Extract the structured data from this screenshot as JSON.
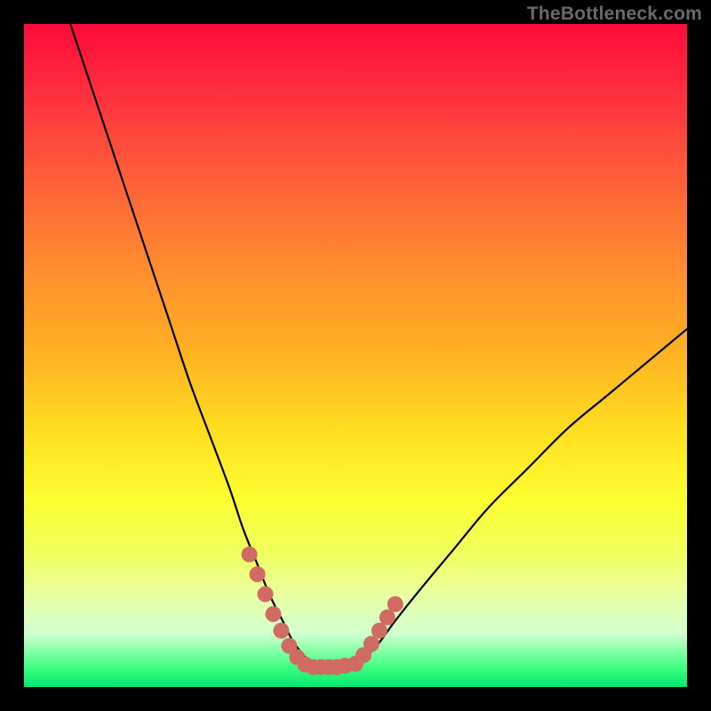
{
  "watermark": {
    "text": "TheBottleneck.com"
  },
  "chart_data": {
    "type": "line",
    "title": "",
    "xlabel": "",
    "ylabel": "",
    "xlim": [
      0,
      100
    ],
    "ylim": [
      0,
      100
    ],
    "grid": false,
    "series": [
      {
        "name": "bottleneck-curve",
        "color": "#000000",
        "x": [
          7,
          10,
          13,
          16,
          19,
          22,
          25,
          28,
          31,
          33,
          35,
          37,
          39,
          40.5,
          42,
          43.5,
          45,
          47,
          49,
          50,
          53,
          56,
          60,
          65,
          70,
          76,
          82,
          88,
          94,
          100
        ],
        "y": [
          100,
          91,
          82,
          73,
          64,
          55,
          46,
          38,
          30,
          24,
          19,
          14,
          10,
          7,
          5,
          3.5,
          3,
          3,
          3.2,
          3.5,
          6,
          10,
          15,
          21,
          27,
          33,
          39,
          44,
          49,
          54
        ]
      },
      {
        "name": "marker-dots",
        "color": "#cf6b63",
        "points": [
          {
            "x": 34.0,
            "y": 20.0
          },
          {
            "x": 35.2,
            "y": 17.0
          },
          {
            "x": 36.4,
            "y": 14.0
          },
          {
            "x": 37.6,
            "y": 11.0
          },
          {
            "x": 38.8,
            "y": 8.5
          },
          {
            "x": 40.0,
            "y": 6.2
          },
          {
            "x": 41.2,
            "y": 4.5
          },
          {
            "x": 42.4,
            "y": 3.4
          },
          {
            "x": 43.6,
            "y": 3.0
          },
          {
            "x": 44.8,
            "y": 3.0
          },
          {
            "x": 46.0,
            "y": 3.0
          },
          {
            "x": 47.2,
            "y": 3.0
          },
          {
            "x": 48.4,
            "y": 3.2
          },
          {
            "x": 50.0,
            "y": 3.5
          },
          {
            "x": 51.2,
            "y": 4.8
          },
          {
            "x": 52.4,
            "y": 6.5
          },
          {
            "x": 53.6,
            "y": 8.5
          },
          {
            "x": 54.8,
            "y": 10.5
          },
          {
            "x": 56.0,
            "y": 12.5
          }
        ]
      }
    ]
  }
}
